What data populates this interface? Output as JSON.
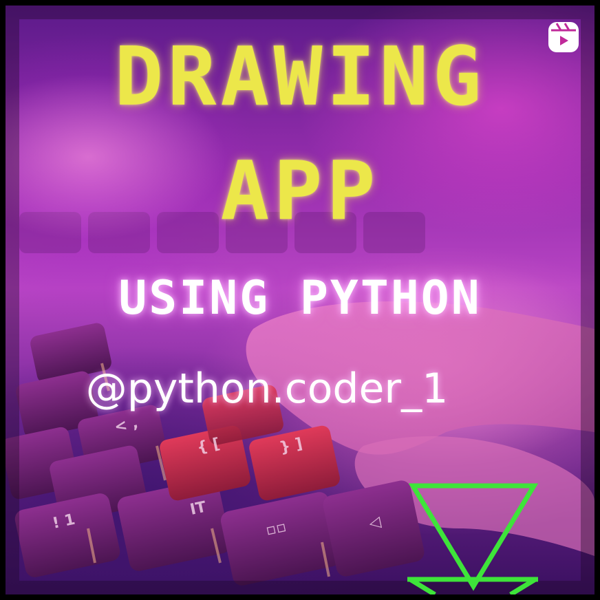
{
  "post": {
    "title_line_1": "DRAWING",
    "title_line_2": "APP",
    "title_line_3": "USING PYTHON",
    "handle": "@python.coder_1"
  },
  "icons": {
    "reel": "reel-play-icon",
    "logo": "green-triangle-logo"
  },
  "colors": {
    "title": "#ece74a",
    "subtitle": "#ffffff",
    "accent_green": "#3ee43a",
    "background_magenta": "#b845c4"
  }
}
